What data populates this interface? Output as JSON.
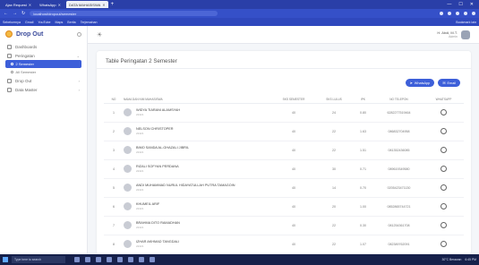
{
  "browser": {
    "tabs": [
      {
        "label": "Ajax Request",
        "active": false
      },
      {
        "label": "WhatsApp",
        "active": false
      },
      {
        "label": "DATA MAHASISWA",
        "active": true
      }
    ],
    "url": "localhost/dropout/semester",
    "bookmarks": [
      "Sebelumnya",
      "Gmail",
      "YouTube",
      "Maps",
      "Berita",
      "Terjemahan"
    ],
    "bookmarks_right": "Bookmark lain"
  },
  "sidebar": {
    "brand": "Drop Out",
    "items": [
      {
        "label": "Dashboards",
        "icon": "home-icon"
      },
      {
        "label": "Peringatan",
        "icon": "alert-icon",
        "expanded": true,
        "children": [
          {
            "label": "2 Semester",
            "active": true
          },
          {
            "label": "All Semester",
            "active": false
          }
        ]
      },
      {
        "label": "Drop Out",
        "icon": "user-icon"
      },
      {
        "label": "Data Master",
        "icon": "database-icon"
      }
    ]
  },
  "topbar": {
    "user_name": "H. Abdi, M.T.",
    "user_role": "Admin"
  },
  "card": {
    "title": "Table Peringatan 2 Semester",
    "buttons": {
      "whatsapp": "WhatsApp",
      "email": "Email"
    }
  },
  "table": {
    "columns": [
      "NO",
      "NAMA DAN NIM MAHASISWA",
      "SKS SEMESTER",
      "SKS LULUS",
      "IPK",
      "NO TELEPON",
      "WHATSAPP"
    ],
    "rows": [
      {
        "no": "1",
        "name": "WIDYA TIARANI ALAMSYAH",
        "sub": "22421",
        "sks": "40",
        "lulus": "24",
        "ipk": "0.80",
        "phone": "6282277519464"
      },
      {
        "no": "2",
        "name": "NELSON CHRISTOPER",
        "sub": "22421",
        "sks": "40",
        "lulus": "22",
        "ipk": "1.63",
        "phone": "086832704958"
      },
      {
        "no": "3",
        "name": "BIMO SANDA AL-GHAZALI JIBRIL",
        "sub": "22421",
        "sks": "40",
        "lulus": "22",
        "ipk": "1.51",
        "phone": "081352436085"
      },
      {
        "no": "4",
        "name": "RIZALI SOFYAN PERDANA",
        "sub": "22421",
        "sks": "40",
        "lulus": "30",
        "ipk": "0.71",
        "phone": "089619349580"
      },
      {
        "no": "5",
        "name": "ANDI MUHAMMAD NURUL HIDAYATULLAH PUTRA TAMAGOIN",
        "sub": "22421",
        "sks": "40",
        "lulus": "14",
        "ipk": "0.70",
        "phone": "0205423471130"
      },
      {
        "no": "6",
        "name": "KHUMEIL ARIF",
        "sub": "22421",
        "sks": "40",
        "lulus": "20",
        "ipk": "1.00",
        "phone": "0852865744721"
      },
      {
        "no": "7",
        "name": "BRAHMA DITO RAMADHAN",
        "sub": "22421",
        "sks": "40",
        "lulus": "22",
        "ipk": "0.30",
        "phone": "081254361708"
      },
      {
        "no": "8",
        "name": "IZHAR AKHMAD TANGDALI",
        "sub": "22421",
        "sks": "40",
        "lulus": "22",
        "ipk": "1.07",
        "phone": "082389762091"
      }
    ]
  },
  "taskbar": {
    "search_placeholder": "Type here to search",
    "time": "6:45 PM",
    "tray_text": "30°C Berawan"
  }
}
